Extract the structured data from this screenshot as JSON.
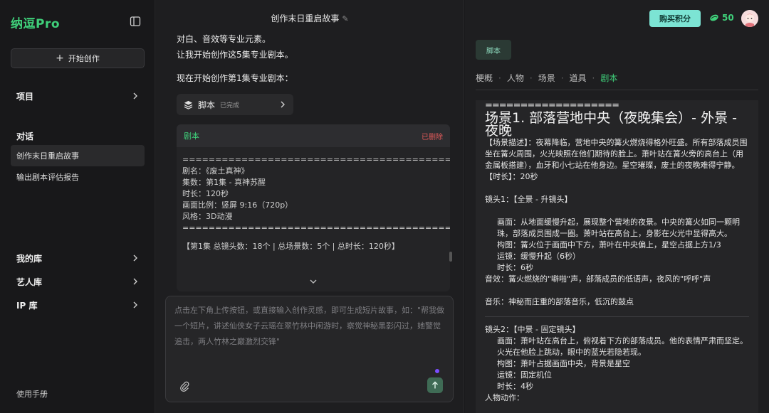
{
  "sidebar": {
    "brand": "纳逗Pro",
    "new_label": "开始创作",
    "projects_label": "项目",
    "conversations_label": "对话",
    "conversations": [
      "创作末日重启故事",
      "输出剧本评估报告"
    ],
    "my_library": "我的库",
    "artist_library": "艺人库",
    "ip_library": "IP 库",
    "manual": "使用手册"
  },
  "chat": {
    "title": "创作末日重启故事",
    "line1": "对白、音效等专业元素。",
    "line2": "让我开始创作这5集专业剧本。",
    "line3": "现在开始创作第1集专业剧本：",
    "chip_label": "脚本",
    "chip_status": "已完成",
    "card_title": "剧本",
    "card_status": "已删除",
    "card_lines": [
      "=======================================================================",
      "剧名：《废土真神》",
      "集数：第1集 - 真神苏醒",
      "时长：120秒",
      "画面比例：竖屏 9:16（720p）",
      "风格：3D动漫",
      "======================================================================="
    ],
    "card_summary": "【第1集 总镜头数：18个 | 总场景数：5个 | 总时长：120秒】",
    "input_placeholder": "点击左下角上传按钮，或直接输入创作灵感，即可生成短片故事，如：\"帮我做一个短片，讲述仙侠女子云瑶在翠竹林中闲游时，察觉神秘黑影闪过，她警觉追击，两人竹林之巅激烈交锋\""
  },
  "panel": {
    "buy_label": "购买积分",
    "credits": "50",
    "tag_label": "脚本",
    "tabs": [
      "梗概",
      "人物",
      "场景",
      "道具",
      "剧本"
    ],
    "active_tab": "剧本",
    "doc": {
      "rule": "===================",
      "heading": "场景1. 部落营地中央（夜晚集会）- 外景 - 夜晚",
      "desc": "【场景描述】：夜幕降临，营地中央的篝火燃烧得格外旺盛。所有部落成员围坐在篝火周围，火光映照在他们期待的脸上。萧叶站在篝火旁的高台上（用金属板搭建），血牙和小七站在他身边。星空璀璨，废土的夜晚难得宁静。",
      "duration": "【时长】：20秒",
      "shot1_title": "镜头1：【全景 - 升镜头】",
      "shot1_frame": "画面：从地面缓慢升起，展现整个营地的夜景。中央的篝火如同一颗明珠，部落成员围成一圈。萧叶站在高台上，身影在火光中显得高大。",
      "shot1_comp": "构图：篝火位于画面中下方，萧叶在中央偏上，星空占据上方1/3",
      "shot1_move": "运镜：缓慢升起（6秒）",
      "shot1_dur": "时长：6秒",
      "shot1_sfx": "音效：篝火燃烧的\"噼啪\"声，部落成员的低语声，夜风的\"呼呼\"声",
      "shot1_music": "音乐：神秘而庄重的部落音乐，低沉的鼓点",
      "shot2_title": "镜头2：【中景 - 固定镜头】",
      "shot2_frame": "画面：萧叶站在高台上，俯视着下方的部落成员。他的表情严肃而坚定。火光在他脸上跳动，眼中的蓝光若隐若现。",
      "shot2_comp": "构图：萧叶占据画面中央，背景是星空",
      "shot2_move": "运镜：固定机位",
      "shot2_dur": "时长：4秒",
      "shot2_next": "人物动作："
    }
  },
  "colors": {
    "accent": "#3fd07a",
    "buy": "#7ce4d4",
    "delete": "#e25a5a"
  }
}
